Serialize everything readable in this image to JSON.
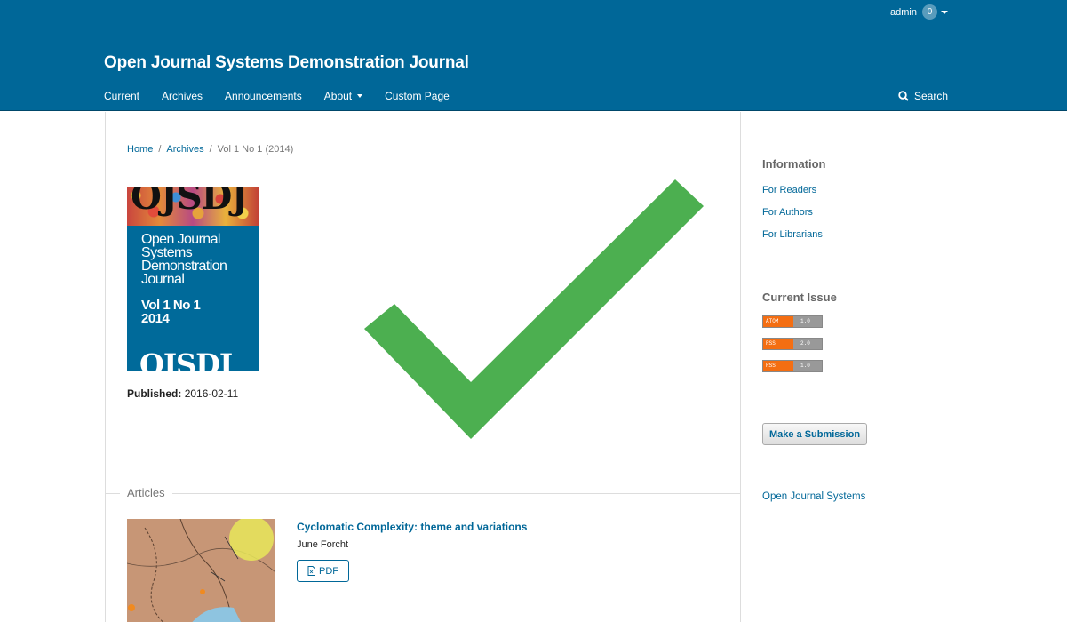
{
  "header": {
    "user": "admin",
    "task_count": "0",
    "site_name": "Open Journal Systems Demonstration Journal",
    "nav": [
      {
        "label": "Current"
      },
      {
        "label": "Archives"
      },
      {
        "label": "Announcements"
      },
      {
        "label": "About"
      },
      {
        "label": "Custom Page"
      }
    ],
    "search_label": "Search"
  },
  "breadcrumb": {
    "home": "Home",
    "archives": "Archives",
    "current": "Vol 1 No 1 (2014)"
  },
  "cover": {
    "logo_text": "OJSDJ",
    "journal_title": "Open Journal Systems Demonstration Journal",
    "volume": "Vol 1 No 1",
    "year": "2014"
  },
  "published": {
    "label": "Published:",
    "date": "2016-02-11"
  },
  "articles": {
    "section_title": "Articles",
    "items": [
      {
        "title": "Cyclomatic Complexity: theme and variations",
        "author": "June Forcht",
        "galley": "PDF"
      }
    ]
  },
  "sidebar": {
    "info_title": "Information",
    "info_links": [
      "For Readers",
      "For Authors",
      "For Librarians"
    ],
    "current_issue_title": "Current Issue",
    "feeds": [
      {
        "type": "ATOM",
        "version": "1.0"
      },
      {
        "type": "RSS",
        "version": "2.0"
      },
      {
        "type": "RSS",
        "version": "1.0"
      }
    ],
    "submit_label": "Make a Submission",
    "ojs_link": "Open Journal Systems"
  },
  "colors": {
    "brand": "#006798",
    "check": "#4caf50"
  },
  "icons": {
    "search": "search-icon",
    "pdf": "pdf-file-icon",
    "check": "checkmark-icon"
  }
}
